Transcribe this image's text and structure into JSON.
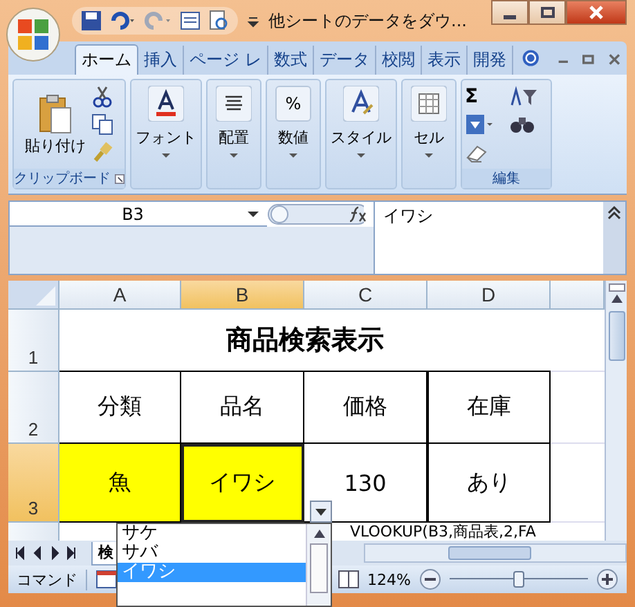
{
  "window": {
    "title": "他シートのデータをダウ..."
  },
  "ribbon_tabs": [
    {
      "label": "ホーム",
      "selected": true
    },
    {
      "label": "挿入",
      "selected": false
    },
    {
      "label": "ページ レ",
      "selected": false
    },
    {
      "label": "数式",
      "selected": false
    },
    {
      "label": "データ",
      "selected": false
    },
    {
      "label": "校閲",
      "selected": false
    },
    {
      "label": "表示",
      "selected": false
    },
    {
      "label": "開発",
      "selected": false
    }
  ],
  "ribbon_groups": [
    {
      "kind": "clipboard",
      "label": "貼り付け",
      "group_label": "クリップボード"
    },
    {
      "kind": "font",
      "label": "フォント"
    },
    {
      "kind": "align",
      "label": "配置"
    },
    {
      "kind": "number",
      "label": "数値",
      "icon_text": "%"
    },
    {
      "kind": "style",
      "label": "スタイル"
    },
    {
      "kind": "cells",
      "label": "セル"
    },
    {
      "kind": "editing",
      "group_label": "編集",
      "icon_text": "Σ"
    }
  ],
  "name_box": "B3",
  "formula": "イワシ",
  "columns": [
    {
      "label": "A",
      "selected": false
    },
    {
      "label": "B",
      "selected": true
    },
    {
      "label": "C",
      "selected": false
    },
    {
      "label": "D",
      "selected": false
    }
  ],
  "rows": [
    {
      "label": "1",
      "selected": false,
      "kind": "title",
      "text": "商品検索表示"
    },
    {
      "label": "2",
      "selected": false,
      "kind": "cells",
      "cells": [
        {
          "text": "分類",
          "selected": false
        },
        {
          "text": "品名",
          "selected": false
        },
        {
          "text": "価格",
          "selected": false
        },
        {
          "text": "在庫",
          "selected": false
        }
      ]
    },
    {
      "label": "3",
      "selected": true,
      "kind": "cells",
      "cells": [
        {
          "text": "魚",
          "selected": false,
          "color": "#ffff00"
        },
        {
          "text": "イワシ",
          "selected": true,
          "color": "#ffff00"
        },
        {
          "text": "130",
          "selected": false
        },
        {
          "text": "あり",
          "selected": false
        }
      ]
    }
  ],
  "row4_text": "VLOOKUP(B3,商品表,2,FA",
  "sheet_tabs": [
    {
      "label": "検",
      "selected": true
    }
  ],
  "dropdown": {
    "items": [
      {
        "label": "サケ",
        "selected": false
      },
      {
        "label": "サバ",
        "selected": false
      },
      {
        "label": "イワシ",
        "selected": true
      }
    ]
  },
  "status_bar": {
    "mode": "コマンド",
    "zoom": "124%",
    "zoom_slider": {
      "level": 0.5
    }
  }
}
